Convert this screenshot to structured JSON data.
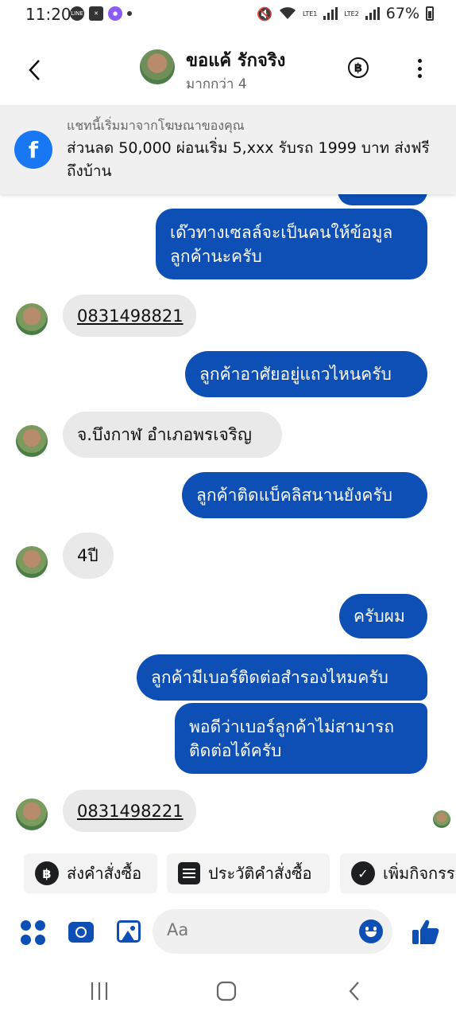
{
  "status_bar": {
    "time": "11:20",
    "battery": "67%",
    "sim1": "LTE1",
    "sim2": "LTE2"
  },
  "header": {
    "contact_name": "ขอแค้ รักจริง",
    "subtitle": "มากกว่า 4"
  },
  "ad_banner": {
    "source_text": "แชทนี้เริ่มมาจากโฆษณาของคุณ",
    "headline": "ส่วนลด 50,000 ผ่อนเริ่ม 5,xxx รับรถ 1999 บาท ส่งฟรีถึงบ้าน"
  },
  "messages": [
    {
      "dir": "out",
      "text": "เด๊วทางเซลล์จะเป็นคนให้ข้อมูลลูกค้านะครับ"
    },
    {
      "dir": "in",
      "text": "0831498821"
    },
    {
      "dir": "out",
      "text": "ลูกค้าอาศัยอยู่แถวไหนครับ"
    },
    {
      "dir": "in",
      "text": "จ.บึงกาฬ อำเภอพรเจริญ"
    },
    {
      "dir": "out",
      "text": "ลูกค้าติดแบ็คลิสนานยังครับ"
    },
    {
      "dir": "in",
      "text": "4ปี"
    },
    {
      "dir": "out",
      "text": "ครับผม"
    },
    {
      "dir": "out",
      "text": "ลูกค้ามีเบอร์ติดต่อสำรองไหมครับ"
    },
    {
      "dir": "out",
      "text": "พอดีว่าเบอร์ลูกค้าไม่สามารถติดต่อได้ครับ"
    },
    {
      "dir": "in",
      "text": "0831498221"
    }
  ],
  "quick_actions": [
    {
      "label": "ส่งคำสั่งซื้อ",
      "icon": "baht-icon"
    },
    {
      "label": "ประวัติคำสั่งซื้อ",
      "icon": "order-history-icon"
    },
    {
      "label": "เพิ่มกิจกรรม",
      "icon": "check-circle-icon"
    }
  ],
  "composer": {
    "placeholder": "Aa"
  },
  "colors": {
    "accent": "#0d4fb5",
    "incoming_bubble": "#e9e9ea",
    "banner_bg": "#f0f0f0"
  }
}
